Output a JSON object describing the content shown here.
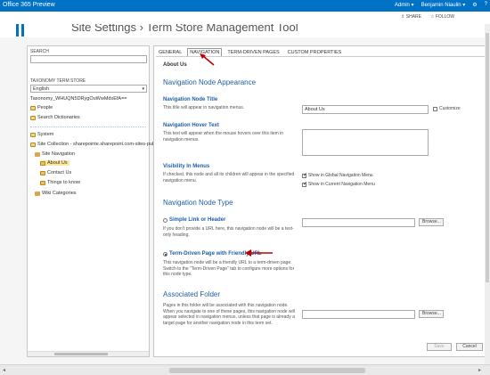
{
  "suite": {
    "title": "Office 365 Preview",
    "user": "Admin ▾",
    "user_name": "Benjamin Niaulin ▾",
    "gear_icon": "gear-icon",
    "help_icon": "help-icon"
  },
  "share": {
    "share_label": "SHARE",
    "follow_label": "FOLLOW"
  },
  "page": {
    "title": "Site Settings › Term Store Management Tool"
  },
  "left": {
    "search_label": "SEARCH",
    "store_label": "TAXONOMY TERM STORE",
    "language": "English",
    "store_name": "Taxonomy_WHUQN5DRygOuWwMdxEfA==",
    "items": {
      "people": "People",
      "search_dict": "Search Dictionaries",
      "system": "System",
      "site_collection": "Site Collection - sharepointe.sharepoint.com-sites-publishing",
      "site_nav": "Site Navigation",
      "about": "About Us",
      "contact": "Contact Us",
      "things": "Things to know",
      "wiki": "Wiki Categories"
    }
  },
  "tabs": {
    "general": "GENERAL",
    "navigation": "NAVIGATION",
    "term_driven": "TERM-DRIVEN PAGES",
    "custom": "CUSTOM PROPERTIES"
  },
  "form": {
    "term_name": "About Us",
    "appearance_head": "Navigation Node Appearance",
    "node_title_label": "Navigation Node Title",
    "node_title_desc": "This title will appear in navigation menus.",
    "node_title_value": "About Us",
    "customize_label": "Customize",
    "hover_label": "Navigation Hover Text",
    "hover_desc": "This text will appear when the mouse hovers over this item in navigation menus.",
    "visibility_label": "Visibility In Menus",
    "visibility_desc": "If checked, this node and all its children will appear in the specified navigation menu.",
    "show_global": "Show in Global Navigation Menu",
    "show_current": "Show in Current Navigation Menu",
    "type_head": "Navigation Node Type",
    "simple_link_label": "Simple Link or Header",
    "simple_link_desc": "If you don't provide a URL here, this navigation node will be a text-only heading.",
    "browse_label": "Browse...",
    "term_driven_label": "Term-Driven Page with Friendly URL",
    "term_driven_desc": "This navigation node will be a friendly URL to a term-driven page. Switch to the \"Term-Driven Page\" tab to configure more options for this node type.",
    "folder_head": "Associated Folder",
    "folder_desc": "Pages in this folder will be associated with this navigation node. When you navigate to one of these pages, this navigation node will appear selected in navigation menus, unless that page is already a target page for another navigation node in this term set.",
    "save_label": "Save",
    "cancel_label": "Cancel"
  },
  "colors": {
    "accent": "#0072c6",
    "heading": "#1e5fa5",
    "arrow": "#c00000"
  }
}
